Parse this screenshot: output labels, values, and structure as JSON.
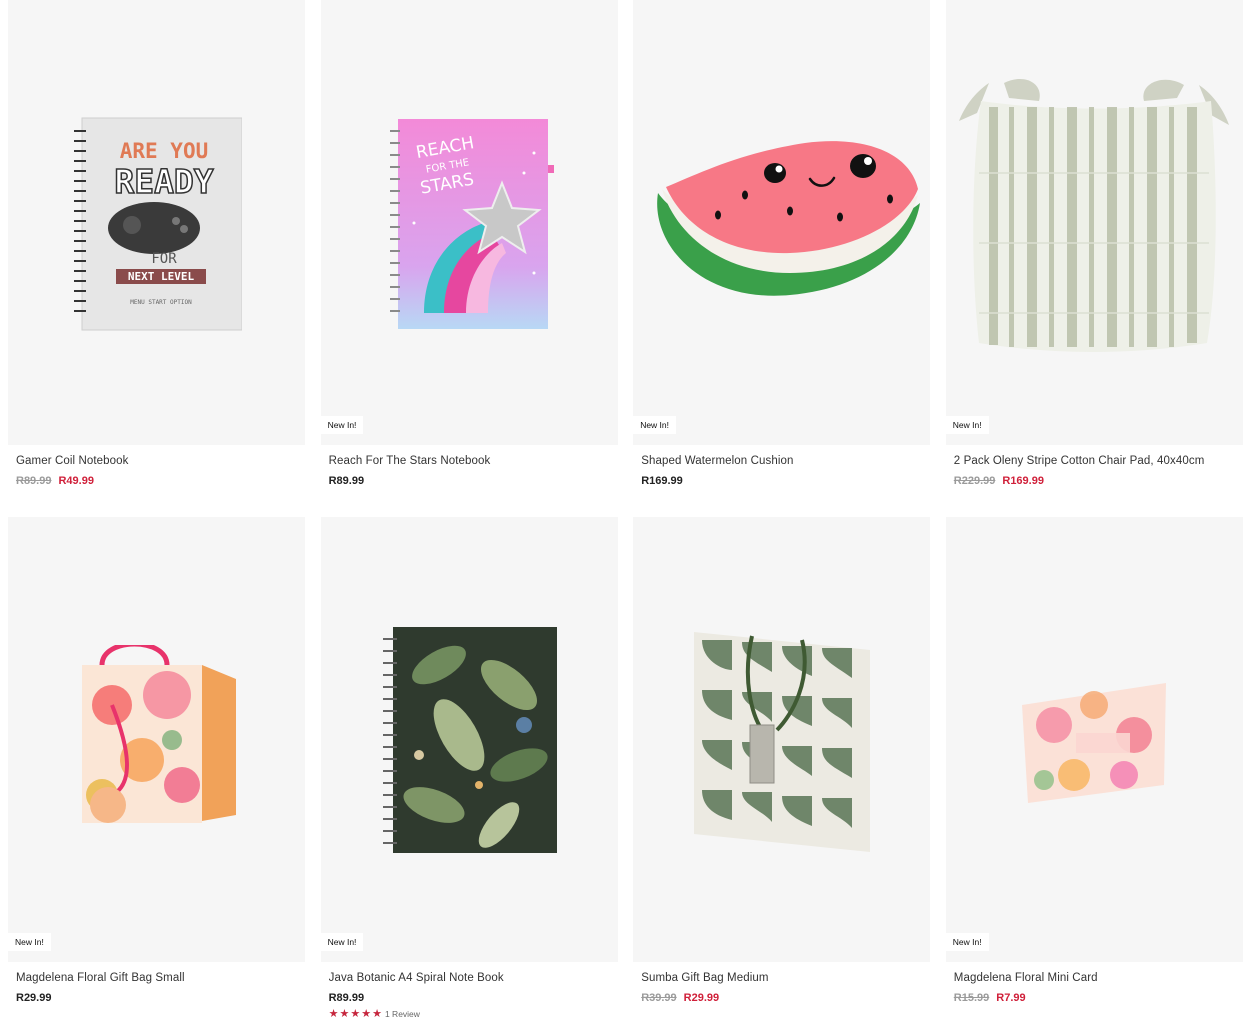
{
  "badge_text": "New In!",
  "colors": {
    "sale_price": "#d0203a",
    "was_price": "#9b9b9b",
    "star": "#c6263d",
    "tile_bg": "#f6f6f6"
  },
  "products": [
    {
      "name": "Gamer Coil Notebook",
      "badge": "",
      "price": "",
      "was": "R89.99",
      "now": "R49.99",
      "cover_text": {
        "line1": "ARE YOU",
        "line2": "READY",
        "line3": "FOR",
        "line4": "NEXT LEVEL",
        "line5": "MENU  START  OPTION"
      }
    },
    {
      "name": "Reach For The Stars Notebook",
      "badge": "New In!",
      "price": "R89.99",
      "was": "",
      "now": "",
      "cover_text": {
        "line1": "REACH",
        "line2": "FOR THE",
        "line3": "STARS"
      }
    },
    {
      "name": "Shaped Watermelon Cushion",
      "badge": "New In!",
      "price": "R169.99",
      "was": "",
      "now": ""
    },
    {
      "name": "2 Pack Oleny Stripe Cotton Chair Pad, 40x40cm",
      "badge": "New In!",
      "price": "",
      "was": "R229.99",
      "now": "R169.99"
    },
    {
      "name": "Magdelena Floral Gift Bag Small",
      "badge": "New In!",
      "price": "R29.99",
      "was": "",
      "now": ""
    },
    {
      "name": "Java Botanic A4 Spiral Note Book",
      "badge": "New In!",
      "price": "R89.99",
      "was": "",
      "now": "",
      "rating": {
        "stars": 5,
        "reviews": "1 Review"
      }
    },
    {
      "name": "Sumba Gift Bag Medium",
      "badge": "",
      "price": "",
      "was": "R39.99",
      "now": "R29.99"
    },
    {
      "name": "Magdelena Floral Mini Card",
      "badge": "New In!",
      "price": "",
      "was": "R15.99",
      "now": "R7.99"
    }
  ]
}
